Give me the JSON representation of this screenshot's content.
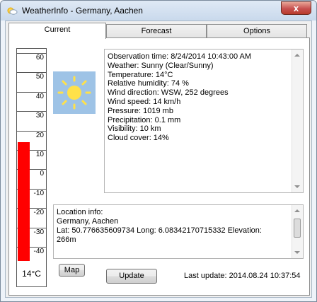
{
  "window": {
    "title": "WeatherInfo - Germany, Aachen",
    "close_glyph": "x"
  },
  "tabs": [
    {
      "label": "Current",
      "active": true
    },
    {
      "label": "Forecast",
      "active": false
    },
    {
      "label": "Options",
      "active": false
    }
  ],
  "thermometer": {
    "scale": [
      "60",
      "50",
      "40",
      "30",
      "20",
      "10",
      "0",
      "-10",
      "-20",
      "-30",
      "-40"
    ],
    "value_celsius": 14,
    "value_label": "14°C",
    "mercury_color": "#ff0000"
  },
  "weather_icon": {
    "name": "sunny-icon",
    "background": "#9ec3e6",
    "sun_color": "#ffe14a"
  },
  "observation": [
    "Observation time: 8/24/2014 10:43:00 AM",
    "Weather: Sunny (Clear/Sunny)",
    "Temperature: 14°C",
    "Relative humidity: 74 %",
    "Wind direction: WSW,  252 degrees",
    "Wind speed: 14 km/h",
    "Pressure: 1019 mb",
    "Precipitation: 0.1 mm",
    "Visibility: 10 km",
    "Cloud cover: 14%"
  ],
  "location": {
    "lines": [
      "Location info:",
      "Germany, Aachen",
      "Lat: 50.776635609734 Long: 6.08342170715332 Elevation:",
      "266m"
    ]
  },
  "buttons": {
    "map": "Map",
    "update": "Update"
  },
  "status": {
    "last_update": "Last update: 2014.08.24 10:37:54"
  }
}
